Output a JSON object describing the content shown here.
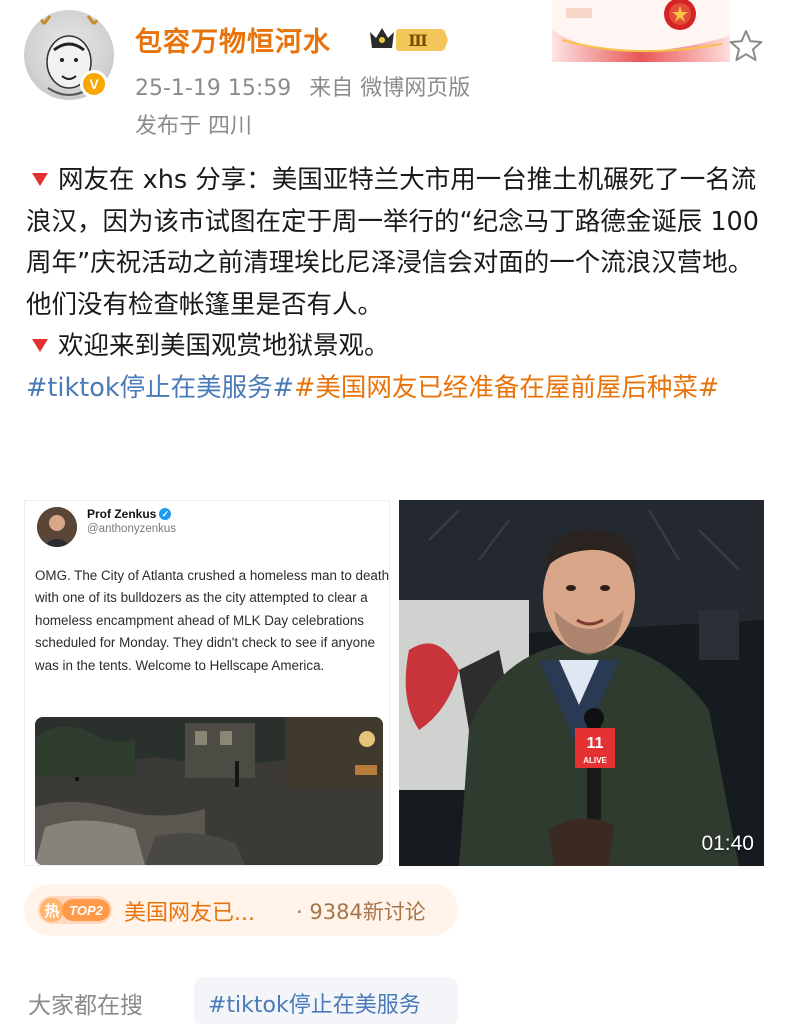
{
  "author": {
    "name": "包容万物恒河水",
    "level": "Ⅲ",
    "verified": "V",
    "timestamp": "25-1-19 15:59",
    "source": "来自 微博网页版",
    "location": "发布于 四川"
  },
  "post": {
    "line1": "网友在 xhs 分享：美国亚特兰大市用一台推土机碾死了一名流浪汉，因为该市试图在定于周一举行的“纪念马丁路德金诞辰 100 周年”庆祝活动之前清理埃比尼泽浸信会对面的一个流浪汉营地。他们没有检查帐篷里是否有人。",
    "line2": "欢迎来到美国观赏地狱景观。",
    "hashtag1": "#tiktok停止在美服务#",
    "hashtag2": "#美国网友已经准备在屋前屋后种菜#"
  },
  "tweet": {
    "name": "Prof Zenkus",
    "handle": "@anthonyzenkus",
    "body": "OMG. The City of Atlanta crushed a homeless man to death with one of its bulldozers as the city attempted to clear a homeless encampment ahead of MLK Day celebrations scheduled for Monday. They didn't check to see if anyone was in the tents. Welcome to Hellscape America."
  },
  "video": {
    "duration": "01:40",
    "mic_label": "ALIVE",
    "mic_logo": "11"
  },
  "topic": {
    "hot_label": "热",
    "rank": "TOP2",
    "title": "美国网友已...",
    "count": "· 9384新讨论"
  },
  "search": {
    "label": "大家都在搜",
    "chip": "#tiktok停止在美服务"
  },
  "colors": {
    "accent_orange": "#e8730b",
    "hashtag_blue": "#4a7ab8",
    "meta_gray": "#8c8c8c",
    "bullet_red": "#e03131"
  }
}
